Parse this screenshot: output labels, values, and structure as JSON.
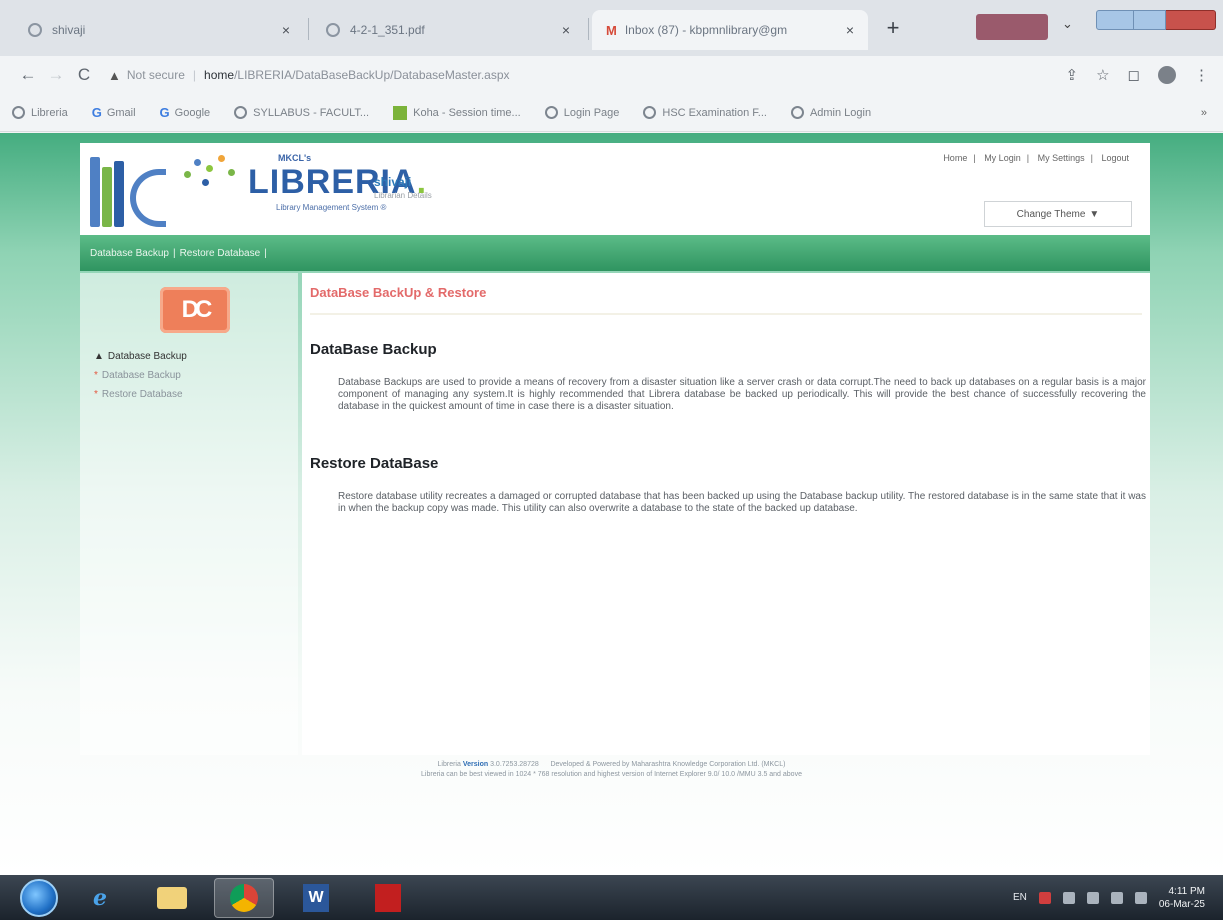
{
  "browser": {
    "tabs": [
      {
        "title": "shivaji",
        "close": "×"
      },
      {
        "title": "4-2-1_351.pdf",
        "close": "×"
      },
      {
        "title": "Inbox (87) - kbpmnlibrary@gm",
        "close": "×"
      }
    ],
    "new_tab": "+",
    "tabs_menu": "⌄",
    "nav": {
      "back": "←",
      "forward": "→",
      "reload": "C"
    },
    "address": {
      "warning": "▲",
      "security": "Not secure",
      "separator": "|",
      "host": "home",
      "path": "/LIBRERIA/DataBaseBackUp/DatabaseMaster.aspx"
    },
    "toolbar_icons": {
      "share": "⇪",
      "bookmark": "☆",
      "sidepanel": "◻",
      "menu": "⋮"
    },
    "bookmarks": [
      {
        "label": "Libreria",
        "icon": "globe"
      },
      {
        "label": "Gmail",
        "icon": "google"
      },
      {
        "label": "Google",
        "icon": "google"
      },
      {
        "label": "SYLLABUS - FACULT...",
        "icon": "globe"
      },
      {
        "label": "Koha - Session time...",
        "icon": "koha"
      },
      {
        "label": "Login Page",
        "icon": "globe"
      },
      {
        "label": "HSC Examination F...",
        "icon": "globe"
      },
      {
        "label": "Admin Login",
        "icon": "globe"
      }
    ],
    "bookmarks_more": "»"
  },
  "header": {
    "brand_top": "MKCL's",
    "brand": "LIBRERIA",
    "brand_dot": ".",
    "brand_sub": "Library Management System ®",
    "user_name": "shivaji",
    "user_sub": "Librarian Details",
    "top_links": [
      "Home",
      "My Login",
      "My Settings",
      "Logout"
    ],
    "link_sep": "|",
    "theme_button": "Change Theme",
    "theme_caret": "▼"
  },
  "nav_bar": {
    "crumbs": [
      "Database Backup",
      "Restore Database"
    ],
    "sep": "|"
  },
  "sidebar": {
    "module_icon": "DC",
    "heading": "Database Backup",
    "heading_arrow": "▲",
    "items": [
      {
        "label": "Database Backup",
        "bullet": "*"
      },
      {
        "label": "Restore Database",
        "bullet": "*"
      }
    ]
  },
  "content": {
    "title": "DataBase BackUp & Restore",
    "backup_heading": "DataBase Backup",
    "backup_text": "Database Backups are used to provide a means of recovery from a disaster situation like a server crash or data corrupt.The need to back up databases on a regular basis is a major component of managing any system.It is highly recommended that Librera database be backed up periodically. This will provide the best chance of successfully recovering the database in the quickest amount of time in case there is a disaster situation.",
    "restore_heading": "Restore DataBase",
    "restore_text": "Restore database utility recreates a damaged or corrupted database that has been backed up using the Database backup utility. The restored database is in the same state that it was in when the backup copy was made. This utility can also overwrite a database to the state of the backed up database."
  },
  "footer": {
    "prefix": "Libreria",
    "version_label": "Version",
    "version": "3.0.7253.28728",
    "credit": "Developed & Powered by Maharashtra Knowledge Corporation Ltd. (MKCL)",
    "line2": "Libreria can be best viewed in 1024 * 768 resolution and highest version of Internet Explorer 9.0/ 10.0 /MMU 3.5 and above"
  },
  "taskbar": {
    "ie_glyph": "e",
    "word_glyph": "W",
    "lang": "EN",
    "time": "4:11 PM",
    "date": "06-Mar-25"
  }
}
